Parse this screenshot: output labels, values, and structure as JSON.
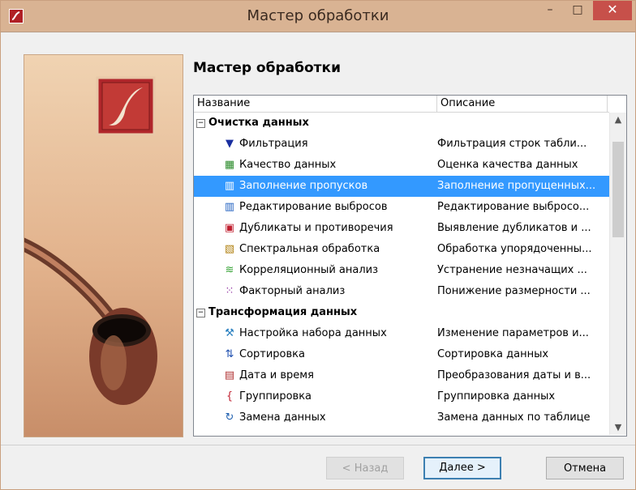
{
  "window": {
    "title": "Мастер обработки",
    "controls": {
      "minimize": "–",
      "maximize": "□",
      "close": "✕"
    }
  },
  "heading": "Мастер обработки",
  "table": {
    "columns": [
      "Название",
      "Описание"
    ],
    "groups": [
      {
        "label": "Очистка данных",
        "toggle": "−",
        "items": [
          {
            "icon": "filter-icon",
            "glyph": "▼",
            "color": "#1a2fa0",
            "name": "Фильтрация",
            "desc": "Фильтрация строк табли..."
          },
          {
            "icon": "data-quality-icon",
            "glyph": "▦",
            "color": "#2a8a2a",
            "name": "Качество данных",
            "desc": "Оценка качества данных"
          },
          {
            "icon": "fill-gaps-icon",
            "glyph": "▥",
            "color": "#c03020",
            "name": "Заполнение пропусков",
            "desc": "Заполнение пропущенных...",
            "selected": true
          },
          {
            "icon": "outliers-icon",
            "glyph": "▥",
            "color": "#2060c0",
            "name": "Редактирование выбросов",
            "desc": "Редактирование выбросо..."
          },
          {
            "icon": "duplicates-icon",
            "glyph": "▣",
            "color": "#c02030",
            "name": "Дубликаты и противоречия",
            "desc": "Выявление дубликатов и ..."
          },
          {
            "icon": "spectral-icon",
            "glyph": "▧",
            "color": "#b08010",
            "name": "Спектральная обработка",
            "desc": "Обработка упорядоченны..."
          },
          {
            "icon": "correlation-icon",
            "glyph": "≋",
            "color": "#30a030",
            "name": "Корреляционный анализ",
            "desc": "Устранение незначащих ..."
          },
          {
            "icon": "factor-icon",
            "glyph": "⁙",
            "color": "#9030a0",
            "name": "Факторный анализ",
            "desc": "Понижение размерности ..."
          }
        ]
      },
      {
        "label": "Трансформация данных",
        "toggle": "−",
        "items": [
          {
            "icon": "wrench-icon",
            "glyph": "⚒",
            "color": "#2a80c0",
            "name": "Настройка набора данных",
            "desc": "Изменение параметров и..."
          },
          {
            "icon": "sort-icon",
            "glyph": "⇅",
            "color": "#2050b0",
            "name": "Сортировка",
            "desc": "Сортировка данных"
          },
          {
            "icon": "datetime-icon",
            "glyph": "▤",
            "color": "#b03030",
            "name": "Дата и время",
            "desc": "Преобразования даты и в..."
          },
          {
            "icon": "grouping-icon",
            "glyph": "{",
            "color": "#c02030",
            "name": "Группировка",
            "desc": "Группировка данных"
          },
          {
            "icon": "replace-icon",
            "glyph": "↻",
            "color": "#2060b0",
            "name": "Замена данных",
            "desc": "Замена данных по таблице"
          }
        ]
      }
    ]
  },
  "buttons": {
    "back": "< Назад",
    "next": "Далее >",
    "cancel": "Отмена"
  },
  "scroll": {
    "up": "▲",
    "down": "▼"
  }
}
